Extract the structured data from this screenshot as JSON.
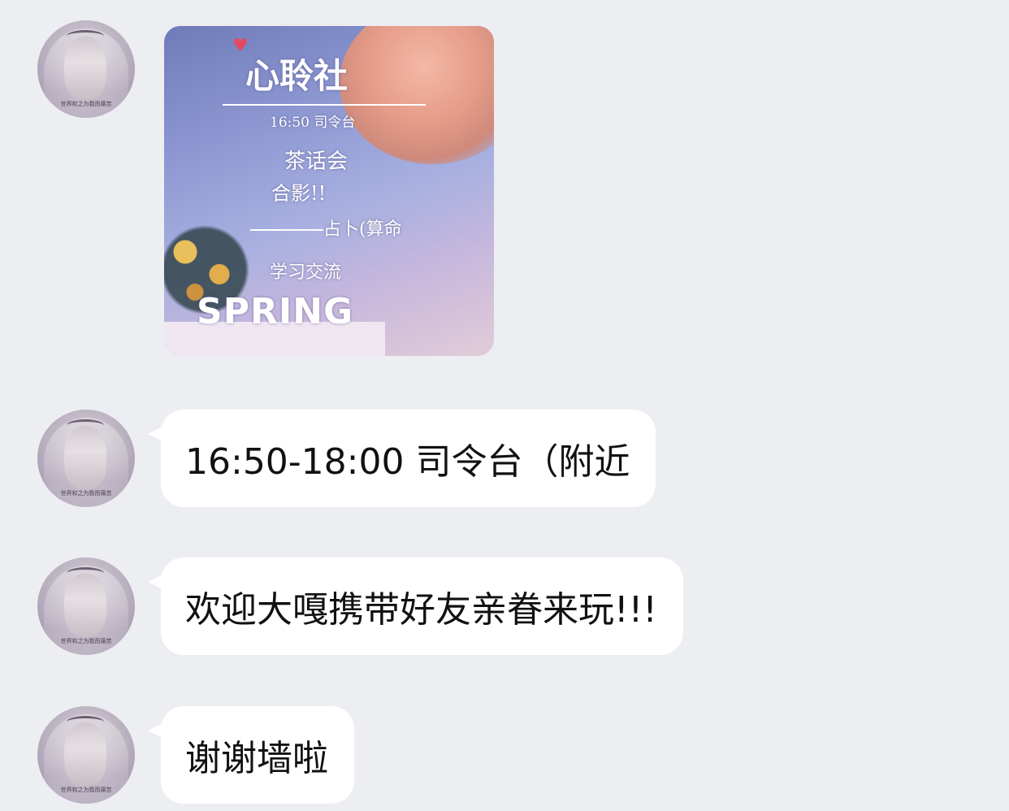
{
  "messages": [
    {
      "type": "image",
      "avatar_watermark": "世界和之为我而痛苦",
      "poster": {
        "title": "心聆社",
        "time": "16:50 司令台",
        "tea": "茶话会",
        "photo": "合影!!",
        "divine": "占卜(算命",
        "study": "学习交流",
        "spring": "SPRING"
      }
    },
    {
      "type": "text",
      "avatar_watermark": "世界和之为我而痛苦",
      "text": "16:50-18:00 司令台（附近"
    },
    {
      "type": "text",
      "avatar_watermark": "世界和之为我而痛苦",
      "text": "欢迎大嘎携带好友亲眷来玩!!!"
    },
    {
      "type": "text",
      "avatar_watermark": "世界和之为我而痛苦",
      "text": "谢谢墙啦"
    }
  ],
  "colors": {
    "background": "#edeef2",
    "bubble": "#ffffff",
    "text": "#111111"
  }
}
